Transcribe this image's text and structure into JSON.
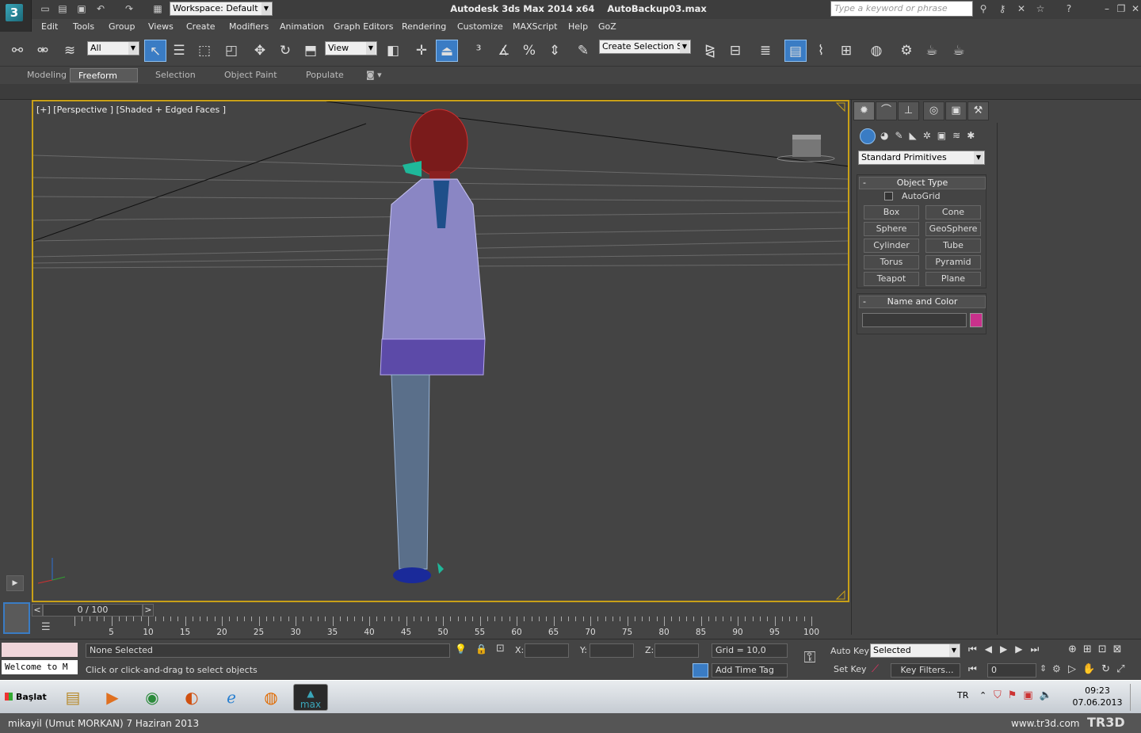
{
  "title_bar": {
    "workspace": "Workspace: Default",
    "app_title": "Autodesk 3ds Max  2014 x64",
    "file_name": "AutoBackup03.max",
    "search_placeholder": "Type a keyword or phrase"
  },
  "menu": [
    "Edit",
    "Tools",
    "Group",
    "Views",
    "Create",
    "Modifiers",
    "Animation",
    "Graph Editors",
    "Rendering",
    "Customize",
    "MAXScript",
    "Help",
    "GoZ"
  ],
  "toolbar": {
    "selection_filter": "All",
    "ref_coord": "View",
    "named_selection": "Create Selection Se"
  },
  "ribbon_tabs": [
    {
      "label": "Modeling"
    },
    {
      "label": "Freeform",
      "active": true
    },
    {
      "label": "Selection"
    },
    {
      "label": "Object Paint"
    },
    {
      "label": "Populate"
    }
  ],
  "viewport": {
    "label": "[+] [Perspective ] [Shaded + Edged Faces ]"
  },
  "command_panel": {
    "category": "Standard Primitives",
    "object_type_title": "Object Type",
    "autogrid_label": "AutoGrid",
    "primitives": [
      "Box",
      "Cone",
      "Sphere",
      "GeoSphere",
      "Cylinder",
      "Tube",
      "Torus",
      "Pyramid",
      "Teapot",
      "Plane"
    ],
    "name_color_title": "Name and Color",
    "object_color": "#c9318c"
  },
  "timeline": {
    "slider_text": "0 / 100",
    "ticks": [
      "5",
      "10",
      "15",
      "20",
      "25",
      "30",
      "35",
      "40",
      "45",
      "50",
      "55",
      "60",
      "65",
      "70",
      "75",
      "80",
      "85",
      "90",
      "95",
      "100"
    ]
  },
  "status": {
    "listener": "Welcome to M",
    "selection": "None Selected",
    "prompt": "Click or click-and-drag to select objects",
    "x_label": "X:",
    "y_label": "Y:",
    "z_label": "Z:",
    "grid": "Grid = 10,0",
    "add_time_tag": "Add Time Tag",
    "auto_key": "Auto Key",
    "set_key": "Set Key",
    "key_mode": "Selected",
    "key_filters": "Key Filters...",
    "frame": "0"
  },
  "taskbar": {
    "start_label": "Başlat",
    "lang": "TR",
    "time": "09:23",
    "date": "07.06.2013",
    "active_app_label": "max"
  },
  "footer": {
    "author": "mikayil (Umut MORKAN)  7 Haziran 2013",
    "site": "www.tr3d.com",
    "logo": "TR3D"
  }
}
